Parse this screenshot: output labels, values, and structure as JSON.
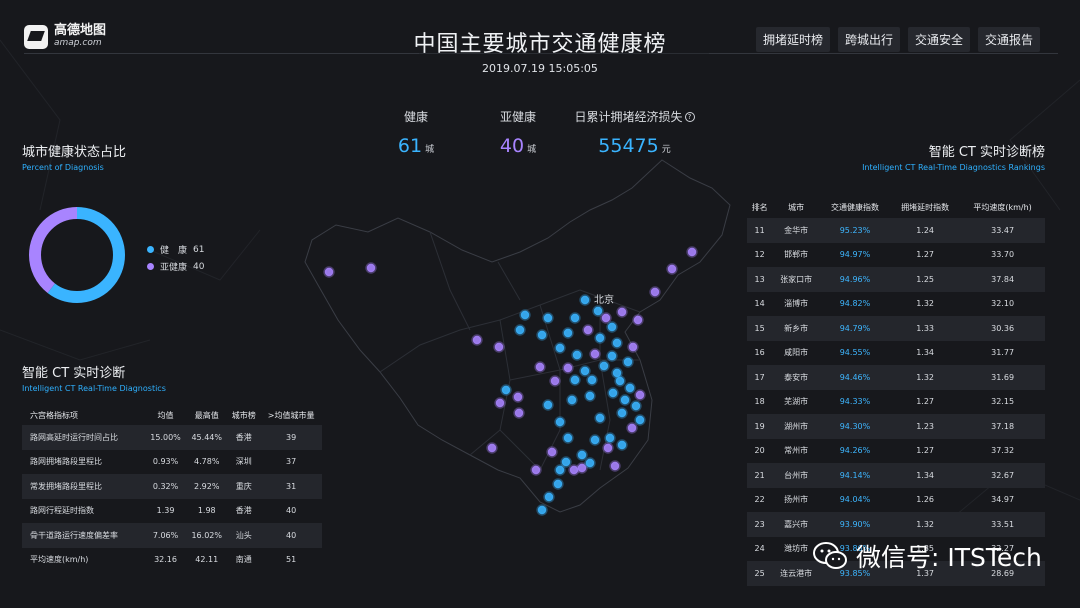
{
  "logo": {
    "cn": "高德地图",
    "en": "amap.com"
  },
  "header": {
    "title": "中国主要城市交通健康榜",
    "datetime": "2019.07.19 15:05:05"
  },
  "nav": [
    "拥堵延时榜",
    "跨城出行",
    "交通安全",
    "交通报告"
  ],
  "stats": {
    "healthy": {
      "label": "健康",
      "value": "61",
      "unit": "城",
      "color": "#3ab4ff"
    },
    "subhealthy": {
      "label": "亚健康",
      "value": "40",
      "unit": "城",
      "color": "#a884ff"
    },
    "loss": {
      "label": "日累计拥堵经济损失",
      "value": "55475",
      "unit": "元",
      "color": "#3ab4ff",
      "icon": "question-circle-icon"
    }
  },
  "donut": {
    "title": "城市健康状态占比",
    "subtitle": "Percent of Diagnosis",
    "items": [
      {
        "label": "健　康",
        "value": 61,
        "color": "#3ab4ff"
      },
      {
        "label": "亚健康",
        "value": 40,
        "color": "#a884ff"
      }
    ]
  },
  "map": {
    "city_label": "北京"
  },
  "diag": {
    "title": "智能 CT 实时诊断",
    "subtitle": "Intelligent CT Real-Time Diagnostics",
    "headers": [
      "六宫格指标项",
      "均值",
      "最高值",
      "城市榜",
      ">均值城市量"
    ],
    "rows": [
      [
        "路网高延时运行时间占比",
        "15.00%",
        "45.44%",
        "香港",
        "39"
      ],
      [
        "路网拥堵路段里程比",
        "0.93%",
        "4.78%",
        "深圳",
        "37"
      ],
      [
        "常发拥堵路段里程比",
        "0.32%",
        "2.92%",
        "重庆",
        "31"
      ],
      [
        "路网行程延时指数",
        "1.39",
        "1.98",
        "香港",
        "40"
      ],
      [
        "骨干道路运行速度偏差率",
        "7.06%",
        "16.02%",
        "汕头",
        "40"
      ],
      [
        "平均速度(km/h)",
        "32.16",
        "42.11",
        "南通",
        "51"
      ]
    ]
  },
  "rank": {
    "title": "智能 CT 实时诊断榜",
    "subtitle": "Intelligent CT Real-Time Diagnostics Rankings",
    "headers": [
      "排名",
      "城市",
      "交通健康指数",
      "拥堵延时指数",
      "平均速度(km/h)"
    ],
    "rows": [
      [
        "11",
        "金华市",
        "95.23%",
        "1.24",
        "33.47"
      ],
      [
        "12",
        "邯郸市",
        "94.97%",
        "1.27",
        "33.70"
      ],
      [
        "13",
        "张家口市",
        "94.96%",
        "1.25",
        "37.84"
      ],
      [
        "14",
        "淄博市",
        "94.82%",
        "1.32",
        "32.10"
      ],
      [
        "15",
        "新乡市",
        "94.79%",
        "1.33",
        "30.36"
      ],
      [
        "16",
        "咸阳市",
        "94.55%",
        "1.34",
        "31.77"
      ],
      [
        "17",
        "泰安市",
        "94.46%",
        "1.32",
        "31.69"
      ],
      [
        "18",
        "芜湖市",
        "94.33%",
        "1.27",
        "32.15"
      ],
      [
        "19",
        "湖州市",
        "94.30%",
        "1.23",
        "37.18"
      ],
      [
        "20",
        "常州市",
        "94.26%",
        "1.27",
        "37.32"
      ],
      [
        "21",
        "台州市",
        "94.14%",
        "1.34",
        "32.67"
      ],
      [
        "22",
        "扬州市",
        "94.04%",
        "1.26",
        "34.97"
      ],
      [
        "23",
        "嘉兴市",
        "93.90%",
        "1.32",
        "33.51"
      ],
      [
        "24",
        "潍坊市",
        "93.86%",
        "1.35",
        "32.27"
      ],
      [
        "25",
        "连云港市",
        "93.85%",
        "1.37",
        "28.69"
      ]
    ]
  },
  "watermark": {
    "text": "微信号: ITSTech",
    "icon": "wechat-icon"
  }
}
